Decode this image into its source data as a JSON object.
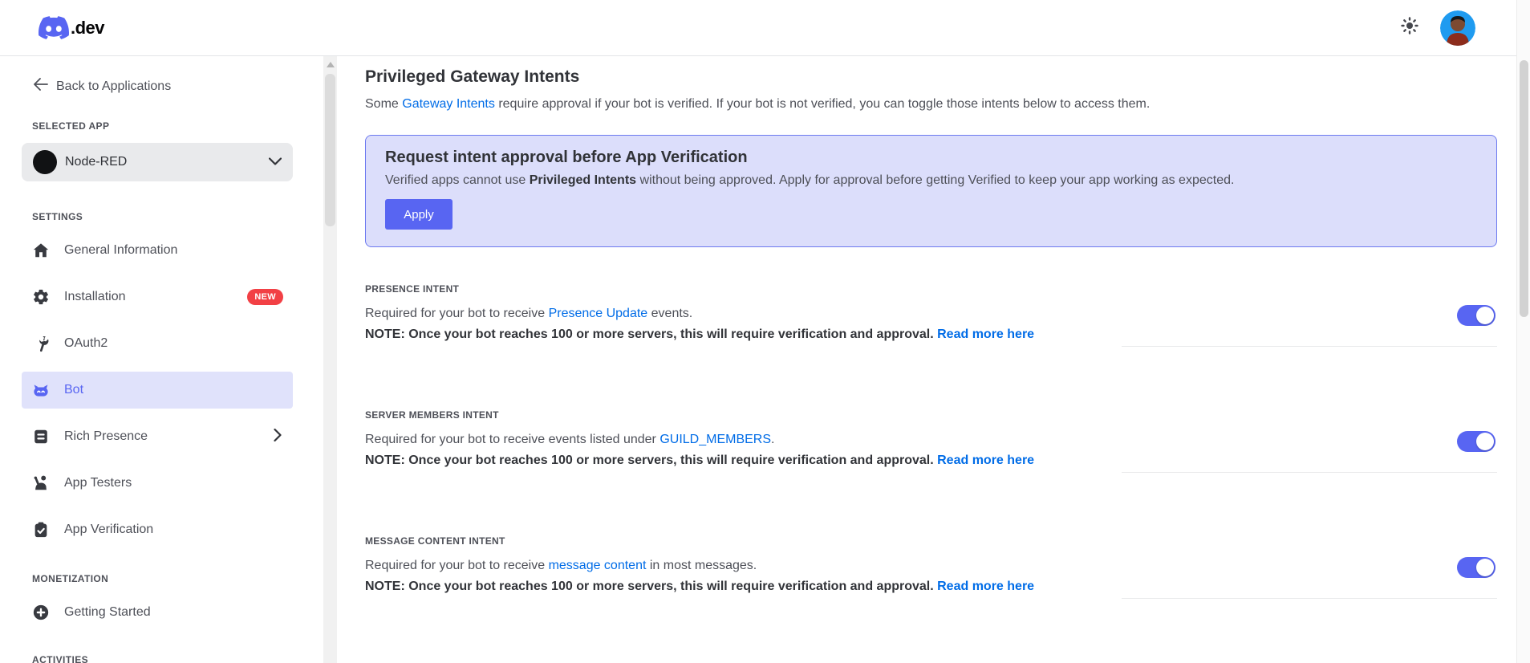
{
  "colors": {
    "blurple": "#5865F2",
    "link_blue": "#006CE7",
    "badge_red": "#F24045",
    "banner_bg": "#DCDEFB",
    "banner_border": "#6C79F0",
    "active_nav_bg": "#E0E2FB",
    "toggle_on": "#5865F2"
  },
  "header": {
    "brand_suffix": ".dev",
    "icons": {
      "logo": "discord-logo-icon",
      "theme": "sun-icon",
      "avatar": "user-avatar"
    }
  },
  "sidebar": {
    "back_label": "Back to Applications",
    "selected_app_label": "SELECTED APP",
    "app_name": "Node-RED",
    "sections": [
      {
        "label": "SETTINGS",
        "items": [
          {
            "label": "General Information",
            "icon": "home-icon"
          },
          {
            "label": "Installation",
            "icon": "gear-icon",
            "badge": "NEW"
          },
          {
            "label": "OAuth2",
            "icon": "wrench-icon"
          },
          {
            "label": "Bot",
            "icon": "bot-icon",
            "active": true
          },
          {
            "label": "Rich Presence",
            "icon": "document-icon",
            "chevron": "right"
          },
          {
            "label": "App Testers",
            "icon": "person-wave-icon"
          },
          {
            "label": "App Verification",
            "icon": "clipboard-check-icon"
          }
        ]
      },
      {
        "label": "MONETIZATION",
        "items": [
          {
            "label": "Getting Started",
            "icon": "plus-circle-icon"
          }
        ]
      },
      {
        "label": "ACTIVITIES",
        "items": []
      }
    ]
  },
  "main": {
    "title": "Privileged Gateway Intents",
    "intro": {
      "pre": "Some ",
      "link": "Gateway Intents",
      "post": " require approval if your bot is verified. If your bot is not verified, you can toggle those intents below to access them."
    },
    "banner": {
      "title": "Request intent approval before App Verification",
      "body_pre": "Verified apps cannot use ",
      "body_bold": "Privileged Intents",
      "body_post": " without being approved. Apply for approval before getting Verified to keep your app working as expected.",
      "button_label": "Apply"
    },
    "intents": [
      {
        "label": "PRESENCE INTENT",
        "desc_pre": "Required for your bot to receive ",
        "desc_link": "Presence Update",
        "desc_post": " events.",
        "note": "NOTE: Once your bot reaches 100 or more servers, this will require verification and approval. ",
        "note_link": "Read more here",
        "enabled": true
      },
      {
        "label": "SERVER MEMBERS INTENT",
        "desc_pre": "Required for your bot to receive events listed under ",
        "desc_link": "GUILD_MEMBERS",
        "desc_post": ".",
        "note": "NOTE: Once your bot reaches 100 or more servers, this will require verification and approval. ",
        "note_link": "Read more here",
        "enabled": true
      },
      {
        "label": "MESSAGE CONTENT INTENT",
        "desc_pre": "Required for your bot to receive ",
        "desc_link": "message content",
        "desc_post": " in most messages.",
        "note": "NOTE: Once your bot reaches 100 or more servers, this will require verification and approval. ",
        "note_link": "Read more here",
        "enabled": true
      }
    ]
  }
}
